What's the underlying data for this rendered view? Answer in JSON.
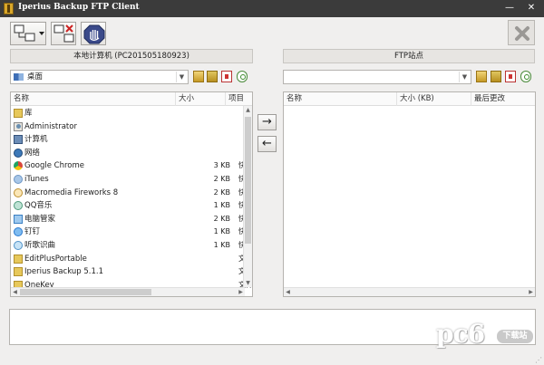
{
  "window": {
    "title": "Iperius Backup FTP Client",
    "minimize_glyph": "—",
    "close_glyph": "✕"
  },
  "toolbar": {
    "buttons": [
      "connect-dropdown-icon",
      "disconnect-icon",
      "stop-hand-icon"
    ],
    "close_icon": "close-x-icon"
  },
  "local": {
    "header": "本地计算机 (PC201505180923)",
    "path": "桌面",
    "columns": [
      "名称",
      "大小",
      "项目"
    ],
    "rows": [
      {
        "icon": "folder",
        "name": "库",
        "size": "",
        "type": ""
      },
      {
        "icon": "user",
        "name": "Administrator",
        "size": "",
        "type": ""
      },
      {
        "icon": "pc",
        "name": "计算机",
        "size": "",
        "type": ""
      },
      {
        "icon": "net",
        "name": "网络",
        "size": "",
        "type": ""
      },
      {
        "icon": "chrome",
        "name": "Google Chrome",
        "size": "3 KB",
        "type": "快捷"
      },
      {
        "icon": "itunes",
        "name": "iTunes",
        "size": "2 KB",
        "type": "快捷"
      },
      {
        "icon": "fw",
        "name": "Macromedia Fireworks 8",
        "size": "2 KB",
        "type": "快捷"
      },
      {
        "icon": "qq",
        "name": "QQ音乐",
        "size": "1 KB",
        "type": "快捷"
      },
      {
        "icon": "guard",
        "name": "电脑管家",
        "size": "2 KB",
        "type": "快捷"
      },
      {
        "icon": "ding",
        "name": "钉钉",
        "size": "1 KB",
        "type": "快捷"
      },
      {
        "icon": "song",
        "name": "听歌识曲",
        "size": "1 KB",
        "type": "快捷"
      },
      {
        "icon": "edit",
        "name": "EditPlusPortable",
        "size": "",
        "type": "文件"
      },
      {
        "icon": "folder",
        "name": "Iperius Backup 5.1.1",
        "size": "",
        "type": "文件"
      },
      {
        "icon": "folder",
        "name": "OneKey",
        "size": "",
        "type": "文件"
      }
    ]
  },
  "remote": {
    "header": "FTP站点",
    "path": "",
    "columns": [
      "名称",
      "大小 (KB)",
      "最后更改"
    ],
    "rows": []
  },
  "transfer": {
    "upload_glyph": "→",
    "download_glyph": "←"
  },
  "watermark": {
    "text": "pc6",
    "badge": "下载站"
  }
}
